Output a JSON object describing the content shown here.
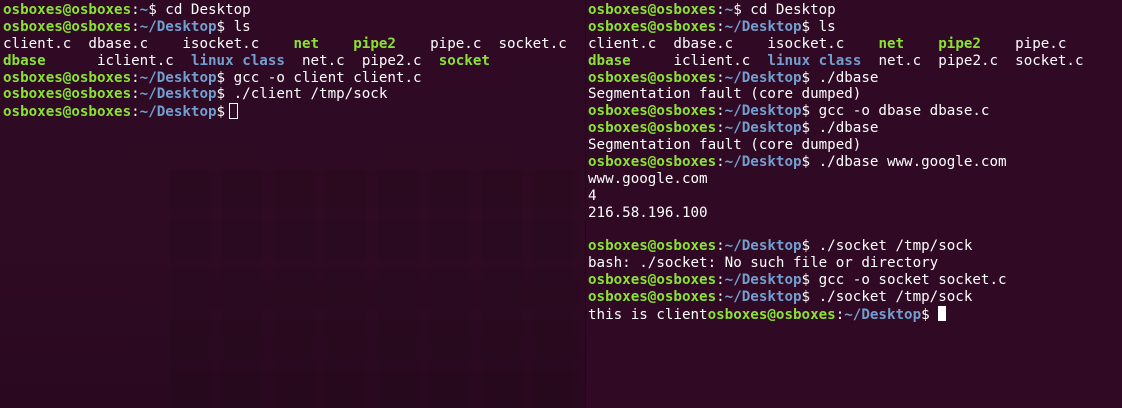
{
  "colors": {
    "background": "#300a24",
    "prompt_user": "#8ae234",
    "prompt_path": "#729fcf",
    "text": "#ffffff"
  },
  "prompt": {
    "user_host": "osboxes@osboxes",
    "colon": ":",
    "home_path": "~",
    "desktop_path": "~/Desktop",
    "dollar": "$"
  },
  "left_terminal": {
    "cmd_cd": " cd Desktop",
    "cmd_ls": " ls",
    "ls_row1": {
      "client_c": "client.c  ",
      "dbase_c": "dbase.c    ",
      "isocket_c": "isocket.c    ",
      "net": "net",
      "gap1": "    ",
      "pipe2": "pipe2",
      "gap2": "    ",
      "pipe_c": "pipe.c  ",
      "socket_c": "socket.c"
    },
    "ls_row2": {
      "dbase": "dbase",
      "gap1": "      ",
      "iclient_c": "iclient.c  ",
      "linux": "linux",
      "gap2": " ",
      "class": "class",
      "gap3": "  ",
      "net_c": "net.c  ",
      "pipe2_c": "pipe2.c  ",
      "socket": "socket"
    },
    "cmd_gcc": " gcc -o client client.c",
    "cmd_run": " ./client /tmp/sock",
    "cmd_empty": " "
  },
  "right_terminal": {
    "cmd_cd": " cd Desktop",
    "cmd_ls": " ls",
    "ls_row1": {
      "client_c": "client.c  ",
      "dbase_c": "dbase.c    ",
      "isocket_c": "isocket.c    ",
      "net": "net",
      "gap1": "    ",
      "pipe2": "pipe2",
      "gap2": "    ",
      "pipe_c": "pipe.c"
    },
    "ls_row2": {
      "dbase": "dbase",
      "gap1": "     ",
      "iclient_c": "iclient.c  ",
      "linux": "linux",
      "gap2": " ",
      "class": "class",
      "gap3": "  ",
      "net_c": "net.c  ",
      "pipe2_c": "pipe2.c  ",
      "socket_c": "socket.c"
    },
    "cmd_dbase1": " ./dbase",
    "out_segfault1": "Segmentation fault (core dumped)",
    "cmd_gcc_dbase": " gcc -o dbase dbase.c",
    "cmd_dbase2": " ./dbase",
    "out_segfault2": "Segmentation fault (core dumped)",
    "cmd_dbase_google": " ./dbase www.google.com",
    "out_host": "www.google.com",
    "out_num": "4",
    "out_ip": "216.58.196.100",
    "out_blank": "",
    "cmd_socket1": " ./socket /tmp/sock",
    "out_bash_err": "bash: ./socket: No such file or directory",
    "cmd_gcc_socket": " gcc -o socket socket.c",
    "cmd_socket2": " ./socket /tmp/sock",
    "out_client_msg": "this is client"
  }
}
